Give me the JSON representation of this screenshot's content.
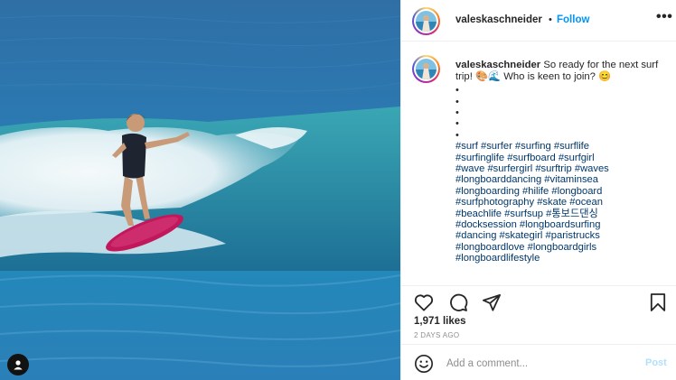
{
  "post": {
    "username": "valeskaschneider",
    "follow_label": "Follow",
    "dot": "•",
    "more_label": "•••",
    "caption_text": "So ready for the next surf trip! 🎨🌊 Who is keen to join? 😊",
    "bullets": [
      "•",
      "•",
      "•",
      "•",
      "•"
    ],
    "hashtags": [
      "#surf",
      "#surfer",
      "#surfing",
      "#surflife",
      "#surfinglife",
      "#surfboard",
      "#surfgirl",
      "#wave",
      "#surfergirl",
      "#surftrip",
      "#waves",
      "#longboarddancing",
      "#vitaminsea",
      "#longboarding",
      "#hilife",
      "#longboard",
      "#surfphotography",
      "#skate",
      "#ocean",
      "#beachlife",
      "#surfsup",
      "#통보드댄싱",
      "#docksession",
      "#longboardsurfing",
      "#dancing",
      "#skategirl",
      "#paristrucks",
      "#longboardlove",
      "#longboardgirls",
      "#longboardlifestyle"
    ],
    "likes": "1,971 likes",
    "time": "2 DAYS AGO",
    "comment_placeholder": "Add a comment...",
    "post_label": "Post"
  },
  "icons": {
    "like": "heart-icon",
    "comment": "comment-icon",
    "share": "paper-plane-icon",
    "save": "bookmark-icon",
    "emoji": "smiley-icon",
    "tag": "user-tag-icon"
  },
  "colors": {
    "link": "#0095f6",
    "hashtag": "#00376b",
    "muted": "#8e8e8e",
    "post_disabled": "#b2dffc"
  }
}
